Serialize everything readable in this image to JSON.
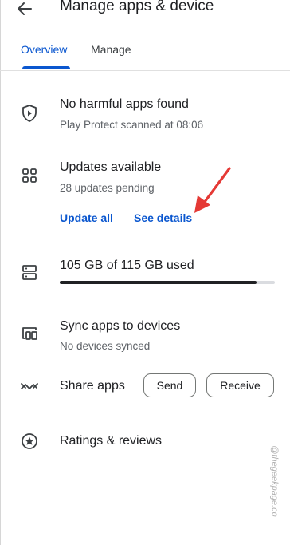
{
  "header": {
    "title": "Manage apps & device",
    "back_icon": "arrow-back-icon"
  },
  "tabs": [
    {
      "label": "Overview",
      "selected": true
    },
    {
      "label": "Manage",
      "selected": false
    }
  ],
  "play_protect": {
    "icon": "shield-icon",
    "title": "No harmful apps found",
    "subtitle": "Play Protect scanned at 08:06"
  },
  "updates": {
    "icon": "apps-grid-icon",
    "title": "Updates available",
    "subtitle": "28 updates pending",
    "update_all_label": "Update all",
    "see_details_label": "See details"
  },
  "storage": {
    "icon": "storage-icon",
    "label": "105 GB of 115 GB used",
    "used_fraction": 0.913
  },
  "sync": {
    "icon": "devices-icon",
    "title": "Sync apps to devices",
    "subtitle": "No devices synced"
  },
  "share": {
    "icon": "share-apps-icon",
    "title": "Share apps",
    "send_label": "Send",
    "receive_label": "Receive"
  },
  "ratings": {
    "icon": "star-circle-icon",
    "title": "Ratings & reviews"
  },
  "watermark": "@thegeekpage.co",
  "colors": {
    "accent": "#0b57cf",
    "annotation_arrow": "#e53935",
    "text_primary": "#202124",
    "text_secondary": "#5f6368"
  }
}
